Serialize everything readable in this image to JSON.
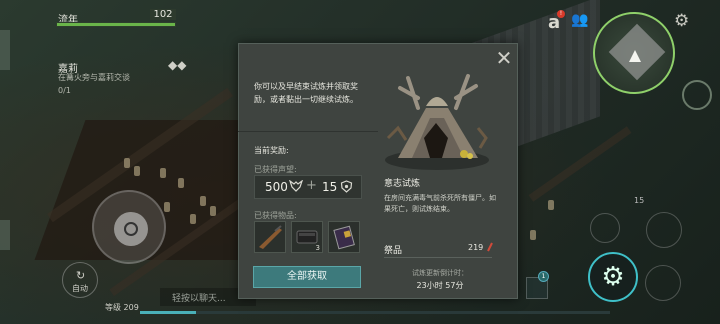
{
  "hud": {
    "hp_label": "流年",
    "hp_value": "102",
    "hp_fraction": 1.0,
    "quest_name": "嘉莉",
    "quest_desc": "在篝火旁与嘉莉交谈",
    "quest_count": "0/1",
    "quest_arrows": "◆◆"
  },
  "top_right": {
    "icon_a": "a",
    "icon_a_badge": "!",
    "people_icon": "👥",
    "gear_icon": "⚙"
  },
  "bottom": {
    "auto_label": "自动",
    "level_label": "等级 209",
    "chat_placeholder": "轻按以聊天...",
    "item_badge": "1",
    "right_number": "15",
    "xp_fraction": 0.12
  },
  "modal": {
    "intro": "你可以及早结束试炼并领取奖励，或者黏出一切继续试炼。",
    "reward_header": "当前奖励:",
    "prestige_label": "已获得声望:",
    "prestige_a": "500",
    "plus": "+",
    "prestige_b": "15",
    "items_label": "已获得物品:",
    "slots": [
      {
        "name": "rifle",
        "qty": ""
      },
      {
        "name": "case",
        "qty": "3"
      },
      {
        "name": "book",
        "qty": ""
      }
    ],
    "claim_button": "全部获取",
    "close_icon": "✕",
    "trial_title": "意志试炼",
    "trial_desc": "在房间充满毒气前杀死所有僵尸。如果死亡，则试炼结束。",
    "offer_label": "祭品",
    "offer_value": "219",
    "refresh_label": "试炼更新倒计时：",
    "refresh_time": "23小时 57分"
  }
}
